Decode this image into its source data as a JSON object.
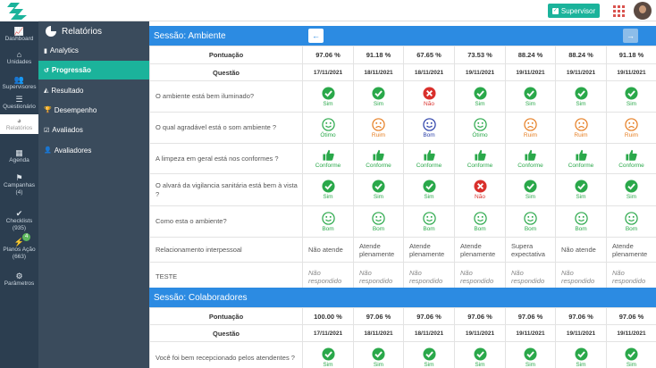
{
  "header": {
    "supervisor_label": "Supervisor"
  },
  "leftnav": [
    {
      "label": "Dashboard",
      "icon": "chart-line-icon"
    },
    {
      "label": "Unidades",
      "icon": "home-icon"
    },
    {
      "label": "Supervisores",
      "icon": "users-icon"
    },
    {
      "label": "Questionário",
      "icon": "list-icon"
    },
    {
      "label": "Relatórios",
      "icon": "pie-chart-icon",
      "active": true
    },
    {
      "label": "Agenda",
      "icon": "calendar-icon"
    },
    {
      "label": "Campanhas",
      "sub": "(4)",
      "icon": "flag-icon"
    },
    {
      "label": "Checklists",
      "sub": "(935)",
      "icon": "check-icon"
    },
    {
      "label": "Planos Ação",
      "sub": "(663)",
      "icon": "bolt-icon",
      "badge": "4"
    },
    {
      "label": "Parâmetros",
      "icon": "cogs-icon"
    }
  ],
  "subnav": {
    "title": "Relatórios",
    "items": [
      {
        "label": "Analytics",
        "icon": "bar-chart-icon"
      },
      {
        "label": "Progressão",
        "icon": "history-icon",
        "active": true
      },
      {
        "label": "Resultado",
        "icon": "area-chart-icon"
      },
      {
        "label": "Desempenho",
        "icon": "trophy-icon"
      },
      {
        "label": "Avaliados",
        "icon": "checkbox-icon"
      },
      {
        "label": "Avaliadores",
        "icon": "user-icon"
      }
    ]
  },
  "sessions": [
    {
      "title": "Sessão: Ambiente",
      "score_label": "Pontuação",
      "scores": [
        "97.06 %",
        "91.18 %",
        "67.65 %",
        "73.53 %",
        "88.24 %",
        "88.24 %",
        "91.18 %"
      ],
      "question_label": "Questão",
      "dates": [
        "17/11/2021",
        "18/11/2021",
        "18/11/2021",
        "19/11/2021",
        "19/11/2021",
        "19/11/2021",
        "19/11/2021"
      ],
      "questions": [
        {
          "text": "O ambiente está bem iluminado?",
          "answers": [
            {
              "icon": "check",
              "label": "Sim"
            },
            {
              "icon": "check",
              "label": "Sim"
            },
            {
              "icon": "cross",
              "label": "Não"
            },
            {
              "icon": "check",
              "label": "Sim"
            },
            {
              "icon": "check",
              "label": "Sim"
            },
            {
              "icon": "check",
              "label": "Sim"
            },
            {
              "icon": "check",
              "label": "Sim"
            }
          ]
        },
        {
          "text": "O qual agradável está o som ambiente ?",
          "answers": [
            {
              "icon": "smile-green",
              "label": "Ótimo"
            },
            {
              "icon": "frown",
              "label": "Ruim"
            },
            {
              "icon": "smile-blue",
              "label": "Bom"
            },
            {
              "icon": "smile-green",
              "label": "Ótimo"
            },
            {
              "icon": "frown",
              "label": "Ruim"
            },
            {
              "icon": "frown",
              "label": "Ruim"
            },
            {
              "icon": "frown",
              "label": "Ruim"
            }
          ]
        },
        {
          "text": "A limpeza em geral está nos conformes ?",
          "answers": [
            {
              "icon": "thumb",
              "label": "Conforme"
            },
            {
              "icon": "thumb",
              "label": "Conforme"
            },
            {
              "icon": "thumb",
              "label": "Conforme"
            },
            {
              "icon": "thumb",
              "label": "Conforme"
            },
            {
              "icon": "thumb",
              "label": "Conforme"
            },
            {
              "icon": "thumb",
              "label": "Conforme"
            },
            {
              "icon": "thumb",
              "label": "Conforme"
            }
          ]
        },
        {
          "text": "O alvará da vigilancia sanitária está bem à vista ?",
          "answers": [
            {
              "icon": "check",
              "label": "Sim"
            },
            {
              "icon": "check",
              "label": "Sim"
            },
            {
              "icon": "check",
              "label": "Sim"
            },
            {
              "icon": "cross",
              "label": "Não"
            },
            {
              "icon": "check",
              "label": "Sim"
            },
            {
              "icon": "check",
              "label": "Sim"
            },
            {
              "icon": "check",
              "label": "Sim"
            }
          ]
        },
        {
          "text": "Como esta o ambiente?",
          "answers": [
            {
              "icon": "smile-green",
              "label": "Bom"
            },
            {
              "icon": "smile-green",
              "label": "Bom"
            },
            {
              "icon": "smile-green",
              "label": "Bom"
            },
            {
              "icon": "smile-green",
              "label": "Bom"
            },
            {
              "icon": "smile-green",
              "label": "Bom"
            },
            {
              "icon": "smile-green",
              "label": "Bom"
            },
            {
              "icon": "smile-green",
              "label": "Bom"
            }
          ]
        },
        {
          "text": "Relacionamento interpessoal",
          "answers": [
            {
              "text": "Não atende"
            },
            {
              "text": "Atende plenamente"
            },
            {
              "text": "Atende plenamente"
            },
            {
              "text": "Atende plenamente"
            },
            {
              "text": "Supera expectativa"
            },
            {
              "text": "Não atende"
            },
            {
              "text": "Atende plenamente"
            }
          ]
        },
        {
          "text": "TESTE",
          "answers": [
            {
              "text": "Não respondido",
              "italic": true
            },
            {
              "text": "Não respondido",
              "italic": true
            },
            {
              "text": "Não respondido",
              "italic": true
            },
            {
              "text": "Não respondido",
              "italic": true
            },
            {
              "text": "Não respondido",
              "italic": true
            },
            {
              "text": "Não respondido",
              "italic": true
            },
            {
              "text": "Não respondido",
              "italic": true
            }
          ]
        }
      ]
    },
    {
      "title": "Sessão: Colaboradores",
      "score_label": "Pontuação",
      "scores": [
        "100.00 %",
        "97.06 %",
        "97.06 %",
        "97.06 %",
        "97.06 %",
        "97.06 %",
        "97.06 %"
      ],
      "question_label": "Questão",
      "dates": [
        "17/11/2021",
        "18/11/2021",
        "18/11/2021",
        "19/11/2021",
        "19/11/2021",
        "19/11/2021",
        "19/11/2021"
      ],
      "questions": [
        {
          "text": "Você foi bem recepcionado pelos atendentes ?",
          "answers": [
            {
              "icon": "check",
              "label": "Sim"
            },
            {
              "icon": "check",
              "label": "Sim"
            },
            {
              "icon": "check",
              "label": "Sim"
            },
            {
              "icon": "check",
              "label": "Sim"
            },
            {
              "icon": "check",
              "label": "Sim"
            },
            {
              "icon": "check",
              "label": "Sim"
            },
            {
              "icon": "check",
              "label": "Sim"
            }
          ]
        }
      ]
    }
  ],
  "colors": {
    "accent": "#1bb39b",
    "session_bar": "#2c8be2",
    "sidebar": "#2c3e50",
    "subnav": "#3a4b5c"
  }
}
